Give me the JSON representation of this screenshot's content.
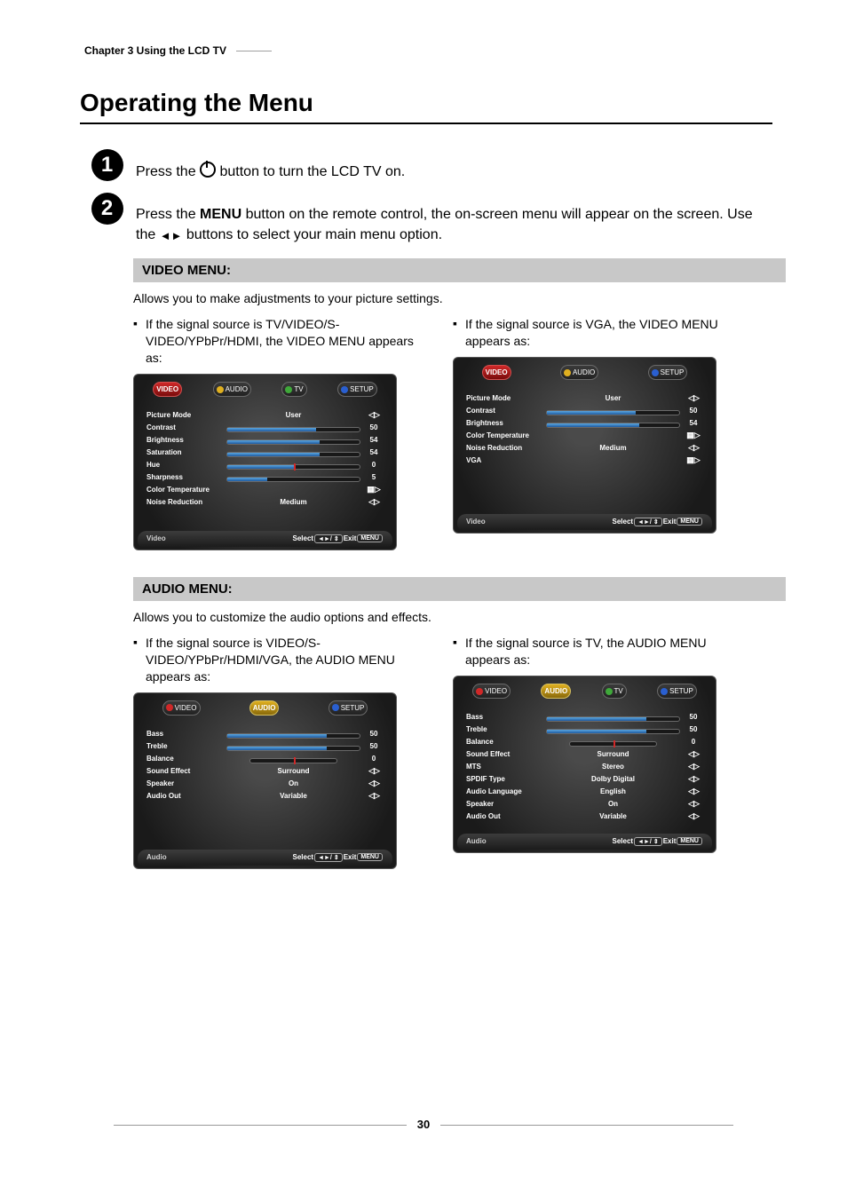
{
  "header": {
    "chapter_line": "Chapter 3 Using the LCD TV"
  },
  "title": "Operating the Menu",
  "steps": {
    "one": {
      "num": "1",
      "text_before": "Press the ",
      "text_after": " button to turn the LCD TV on."
    },
    "two": {
      "num": "2",
      "text_a": "Press the ",
      "menu_word": "MENU",
      "text_b": " button on the remote control, the on-screen menu will appear on the screen. Use the ",
      "text_c": " buttons to select your main menu option."
    }
  },
  "video_section": {
    "bar": "VIDEO MENU:",
    "desc": "Allows you to make adjustments to your picture settings.",
    "left_bullet": "If the signal source is TV/VIDEO/S-VIDEO/YPbPr/HDMI, the VIDEO MENU appears as:",
    "right_bullet": "If the signal source is VGA, the VIDEO MENU appears as:"
  },
  "audio_section": {
    "bar": "AUDIO MENU:",
    "desc": "Allows you to customize the audio options and effects.",
    "left_bullet": "If the signal source is VIDEO/S-VIDEO/YPbPr/HDMI/VGA, the AUDIO MENU appears as:",
    "right_bullet": "If the signal source is TV, the AUDIO MENU appears as:"
  },
  "osd_tabs": {
    "video": "VIDEO",
    "audio": "AUDIO",
    "tv": "TV",
    "setup": "SETUP"
  },
  "osd_footer": {
    "select": "Select",
    "exit": "Exit",
    "menu_key": "MENU",
    "nav_key": "◄►/ ⇕"
  },
  "video_menu_full": {
    "footer_title": "Video",
    "rows": [
      {
        "label": "Picture Mode",
        "type": "text",
        "value": "User",
        "ctrl": "lr"
      },
      {
        "label": "Contrast",
        "type": "slider",
        "value": "50",
        "fill": 67
      },
      {
        "label": "Brightness",
        "type": "slider",
        "value": "54",
        "fill": 70
      },
      {
        "label": "Saturation",
        "type": "slider",
        "value": "54",
        "fill": 70
      },
      {
        "label": "Hue",
        "type": "slider",
        "value": "0",
        "fill": 50,
        "marker": 50
      },
      {
        "label": "Sharpness",
        "type": "slider",
        "value": "5",
        "fill": 30
      },
      {
        "label": "Color Temperature",
        "type": "blank",
        "value": "",
        "ctrl": "r"
      },
      {
        "label": "Noise Reduction",
        "type": "text",
        "value": "Medium",
        "ctrl": "lr"
      }
    ]
  },
  "video_menu_vga": {
    "footer_title": "Video",
    "rows": [
      {
        "label": "Picture Mode",
        "type": "text",
        "value": "User",
        "ctrl": "lr"
      },
      {
        "label": "Contrast",
        "type": "slider",
        "value": "50",
        "fill": 67
      },
      {
        "label": "Brightness",
        "type": "slider",
        "value": "54",
        "fill": 70
      },
      {
        "label": "Color Temperature",
        "type": "blank",
        "value": "",
        "ctrl": "r"
      },
      {
        "label": "Noise Reduction",
        "type": "text",
        "value": "Medium",
        "ctrl": "lr"
      },
      {
        "label": "VGA",
        "type": "blank",
        "value": "",
        "ctrl": "r"
      }
    ]
  },
  "audio_menu_nontv": {
    "footer_title": "Audio",
    "rows": [
      {
        "label": "Bass",
        "type": "slider",
        "value": "50",
        "fill": 75
      },
      {
        "label": "Treble",
        "type": "slider",
        "value": "50",
        "fill": 75
      },
      {
        "label": "Balance",
        "type": "slider",
        "value": "0",
        "fill": 0,
        "marker": 50,
        "track_short": true
      },
      {
        "label": "Sound Effect",
        "type": "text",
        "value": "Surround",
        "ctrl": "lr"
      },
      {
        "label": "Speaker",
        "type": "text",
        "value": "On",
        "ctrl": "lr"
      },
      {
        "label": "Audio Out",
        "type": "text",
        "value": "Variable",
        "ctrl": "lr"
      }
    ]
  },
  "audio_menu_tv": {
    "footer_title": "Audio",
    "rows": [
      {
        "label": "Bass",
        "type": "slider",
        "value": "50",
        "fill": 75
      },
      {
        "label": "Treble",
        "type": "slider",
        "value": "50",
        "fill": 75
      },
      {
        "label": "Balance",
        "type": "slider",
        "value": "0",
        "fill": 0,
        "marker": 50,
        "track_short": true
      },
      {
        "label": "Sound Effect",
        "type": "text",
        "value": "Surround",
        "ctrl": "lr"
      },
      {
        "label": "MTS",
        "type": "text",
        "value": "Stereo",
        "ctrl": "lr"
      },
      {
        "label": "SPDIF Type",
        "type": "text",
        "value": "Dolby Digital",
        "ctrl": "lr"
      },
      {
        "label": "Audio Language",
        "type": "text",
        "value": "English",
        "ctrl": "lr"
      },
      {
        "label": "Speaker",
        "type": "text",
        "value": "On",
        "ctrl": "lr"
      },
      {
        "label": "Audio Out",
        "type": "text",
        "value": "Variable",
        "ctrl": "lr"
      }
    ]
  },
  "page_number": "30"
}
